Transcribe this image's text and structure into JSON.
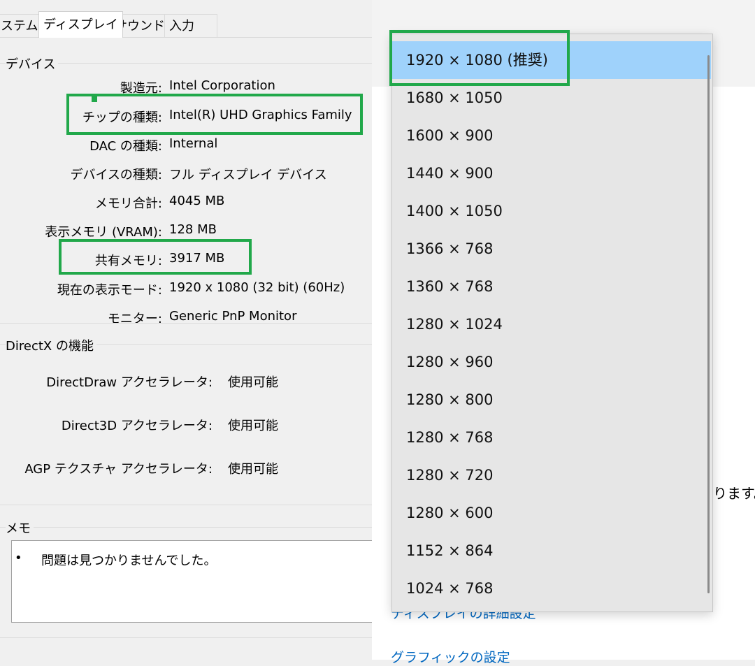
{
  "dxdiag": {
    "tabs": [
      {
        "label": "ステム"
      },
      {
        "label": "ディスプレイ"
      },
      {
        "label": "サウンド"
      },
      {
        "label": "入力"
      }
    ],
    "active_tab": "ディスプレイ",
    "device_group": {
      "title": "デバイス",
      "rows": [
        {
          "label": "製造元:",
          "value": "Intel Corporation"
        },
        {
          "label": "チップの種類:",
          "value": "Intel(R) UHD Graphics Family"
        },
        {
          "label": "DAC の種類:",
          "value": "Internal"
        },
        {
          "label": "デバイスの種類:",
          "value": "フル ディスプレイ デバイス"
        },
        {
          "label": "メモリ合計:",
          "value": "4045 MB"
        },
        {
          "label": "表示メモリ (VRAM):",
          "value": "128 MB"
        },
        {
          "label": "共有メモリ:",
          "value": "3917 MB"
        },
        {
          "label": "現在の表示モード:",
          "value": "1920 x 1080 (32 bit) (60Hz)"
        },
        {
          "label": "モニター:",
          "value": "Generic PnP Monitor"
        }
      ]
    },
    "directx_group": {
      "title": "DirectX の機能",
      "rows": [
        {
          "label": "DirectDraw アクセラレータ:",
          "value": "使用可能"
        },
        {
          "label": "Direct3D アクセラレータ:",
          "value": "使用可能"
        },
        {
          "label": "AGP テクスチャ アクセラレータ:",
          "value": "使用可能"
        }
      ]
    },
    "memo_group": {
      "title": "メモ",
      "bullet": "•",
      "note": "問題は見つかりませんでした。"
    }
  },
  "settings": {
    "side_note": "ります。",
    "links": [
      {
        "label": "ディスプレイの詳細設定"
      },
      {
        "label": "グラフィックの設定"
      }
    ]
  },
  "resolution_dropdown": {
    "selected": "1920 × 1080 (推奨)",
    "options": [
      "1920 × 1080 (推奨)",
      "1680 × 1050",
      "1600 × 900",
      "1440 × 900",
      "1400 × 1050",
      "1366 × 768",
      "1360 × 768",
      "1280 × 1024",
      "1280 × 960",
      "1280 × 800",
      "1280 × 768",
      "1280 × 720",
      "1280 × 600",
      "1152 × 864",
      "1024 × 768"
    ]
  },
  "colors": {
    "highlight": "#21a84a",
    "selected_option": "#9fd2fb",
    "link": "#0067c0"
  }
}
